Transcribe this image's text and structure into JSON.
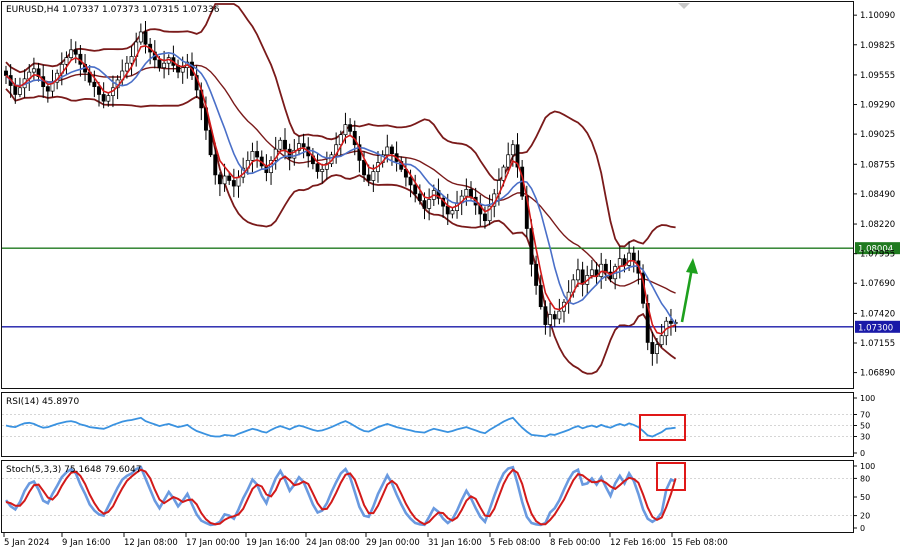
{
  "chart_data": {
    "type": "candlestick",
    "symbol_info": "EURUSD,H4  1.07337 1.07373 1.07315 1.07336",
    "price_axis": {
      "range": [
        1.0677,
        1.1019
      ],
      "ticks": [
        "1.10090",
        "1.09825",
        "1.09555",
        "1.09290",
        "1.09025",
        "1.08755",
        "1.08490",
        "1.08220",
        "1.07955",
        "1.07690",
        "1.07420",
        "1.07155",
        "1.06890"
      ],
      "tick_values": [
        1.1009,
        1.09825,
        1.09555,
        1.0929,
        1.09025,
        1.08755,
        1.0849,
        1.0822,
        1.07955,
        1.0769,
        1.0742,
        1.07155,
        1.0689
      ]
    },
    "x_axis_labels": [
      "5 Jan 2024",
      "9 Jan 16:00",
      "12 Jan 08:00",
      "17 Jan 00:00",
      "19 Jan 16:00",
      "24 Jan 08:00",
      "29 Jan 00:00",
      "31 Jan 16:00",
      "5 Feb 08:00",
      "8 Feb 00:00",
      "12 Feb 16:00",
      "15 Feb 08:00"
    ],
    "horizontal_lines": [
      {
        "label": "1.08004",
        "value": 1.08004,
        "color": "#1f7a1f"
      },
      {
        "label": "1.07300",
        "value": 1.073,
        "color": "#1a1aa8"
      }
    ],
    "closes": [
      1.0955,
      1.0946,
      1.0938,
      1.0944,
      1.0952,
      1.0958,
      1.0961,
      1.0954,
      1.0945,
      1.0941,
      1.0949,
      1.0957,
      1.0965,
      1.0971,
      1.0978,
      1.0974,
      1.0965,
      1.0958,
      1.0949,
      1.0945,
      1.0938,
      1.0932,
      1.0937,
      1.0944,
      1.0951,
      1.0959,
      1.0966,
      1.0972,
      1.0985,
      1.0994,
      1.0983,
      1.0976,
      1.0969,
      1.0962,
      1.0966,
      1.0971,
      1.0964,
      1.0958,
      1.0962,
      1.0967,
      1.0955,
      1.0942,
      1.0926,
      1.0906,
      1.0884,
      1.0866,
      1.0858,
      1.0865,
      1.0861,
      1.0856,
      1.0864,
      1.0872,
      1.0879,
      1.0887,
      1.0882,
      1.0874,
      1.0868,
      1.0879,
      1.0889,
      1.0897,
      1.0889,
      1.0881,
      1.0888,
      1.0894,
      1.0891,
      1.0883,
      1.0876,
      1.0869,
      1.0871,
      1.0876,
      1.0884,
      1.0893,
      1.0902,
      1.0911,
      1.0905,
      1.0893,
      1.0879,
      1.0866,
      1.0861,
      1.0869,
      1.0877,
      1.0884,
      1.0891,
      1.0885,
      1.0878,
      1.0871,
      1.0864,
      1.0857,
      1.0849,
      1.0843,
      1.0836,
      1.0844,
      1.0852,
      1.0845,
      1.0838,
      1.0831,
      1.0834,
      1.0841,
      1.0847,
      1.0853,
      1.0846,
      1.0839,
      1.0831,
      1.0825,
      1.0838,
      1.0849,
      1.0861,
      1.0873,
      1.0884,
      1.0893,
      1.0873,
      1.0847,
      1.0818,
      1.0786,
      1.0767,
      1.0748,
      1.0732,
      1.0741,
      1.0737,
      1.0744,
      1.0752,
      1.0761,
      1.0772,
      1.0781,
      1.0768,
      1.0776,
      1.0781,
      1.0775,
      1.0786,
      1.0779,
      1.0773,
      1.0784,
      1.0791,
      1.0785,
      1.0796,
      1.0789,
      1.0778,
      1.0751,
      1.0716,
      1.0706,
      1.0714,
      1.0722,
      1.0735,
      1.0733,
      1.0734
    ],
    "rsi": {
      "label": "RSI(14) 45.8970",
      "range": [
        0,
        100
      ],
      "ticks": [
        100,
        70,
        50,
        30,
        0
      ],
      "values": [
        50,
        48,
        47,
        51,
        54,
        55,
        53,
        49,
        46,
        47,
        50,
        53,
        55,
        57,
        58,
        56,
        52,
        50,
        47,
        46,
        45,
        44,
        47,
        51,
        54,
        57,
        59,
        60,
        62,
        64,
        58,
        55,
        52,
        49,
        51,
        53,
        50,
        47,
        49,
        51,
        45,
        40,
        37,
        34,
        31,
        30,
        30,
        33,
        32,
        31,
        35,
        38,
        41,
        44,
        42,
        39,
        37,
        42,
        46,
        49,
        46,
        43,
        47,
        50,
        48,
        45,
        42,
        40,
        41,
        44,
        47,
        51,
        55,
        58,
        54,
        49,
        44,
        40,
        39,
        43,
        47,
        50,
        53,
        50,
        47,
        45,
        43,
        41,
        39,
        38,
        37,
        41,
        44,
        42,
        40,
        38,
        40,
        43,
        45,
        47,
        44,
        41,
        38,
        36,
        42,
        47,
        52,
        57,
        61,
        64,
        55,
        46,
        39,
        33,
        32,
        31,
        30,
        34,
        33,
        36,
        39,
        42,
        46,
        49,
        45,
        48,
        50,
        47,
        51,
        48,
        46,
        50,
        53,
        50,
        54,
        51,
        47,
        40,
        32,
        30,
        34,
        38,
        44,
        45,
        46
      ]
    },
    "stoch": {
      "label": "Stoch(5,3,3) 75.1648 79.6047",
      "range": [
        0,
        100
      ],
      "ticks": [
        100,
        80,
        50,
        20,
        0
      ],
      "main": [
        45,
        35,
        30,
        42,
        60,
        72,
        75,
        62,
        44,
        40,
        55,
        68,
        82,
        90,
        95,
        88,
        70,
        55,
        38,
        28,
        22,
        20,
        35,
        50,
        65,
        78,
        84,
        88,
        95,
        98,
        80,
        62,
        44,
        32,
        45,
        58,
        48,
        35,
        44,
        55,
        38,
        22,
        12,
        8,
        5,
        6,
        10,
        22,
        20,
        15,
        30,
        48,
        62,
        78,
        70,
        52,
        40,
        62,
        80,
        92,
        78,
        60,
        70,
        82,
        74,
        56,
        38,
        25,
        28,
        40,
        58,
        74,
        88,
        95,
        82,
        58,
        34,
        20,
        18,
        35,
        55,
        70,
        85,
        72,
        54,
        38,
        24,
        15,
        8,
        6,
        5,
        18,
        32,
        26,
        15,
        8,
        14,
        28,
        45,
        60,
        48,
        32,
        18,
        10,
        30,
        52,
        72,
        88,
        96,
        98,
        72,
        42,
        18,
        8,
        6,
        5,
        8,
        25,
        32,
        45,
        62,
        78,
        90,
        94,
        70,
        72,
        80,
        70,
        82,
        66,
        52,
        72,
        84,
        72,
        88,
        76,
        55,
        30,
        15,
        10,
        15,
        25,
        62,
        78,
        75
      ],
      "signal": [
        42,
        40,
        36,
        36,
        44,
        58,
        69,
        70,
        60,
        49,
        46,
        54,
        68,
        80,
        89,
        91,
        84,
        71,
        54,
        40,
        29,
        23,
        26,
        35,
        50,
        64,
        76,
        83,
        89,
        94,
        91,
        80,
        62,
        46,
        40,
        45,
        50,
        47,
        42,
        45,
        46,
        38,
        24,
        14,
        8,
        6,
        7,
        13,
        17,
        19,
        22,
        31,
        47,
        63,
        70,
        67,
        54,
        51,
        61,
        78,
        83,
        77,
        69,
        71,
        75,
        71,
        56,
        40,
        30,
        31,
        42,
        57,
        73,
        86,
        88,
        78,
        58,
        37,
        24,
        24,
        36,
        53,
        70,
        76,
        70,
        55,
        39,
        26,
        16,
        10,
        6,
        10,
        18,
        25,
        24,
        16,
        12,
        17,
        29,
        44,
        51,
        47,
        33,
        20,
        19,
        31,
        51,
        71,
        85,
        94,
        89,
        71,
        44,
        23,
        11,
        6,
        6,
        13,
        22,
        34,
        46,
        62,
        77,
        87,
        85,
        79,
        74,
        74,
        77,
        73,
        67,
        63,
        69,
        76,
        81,
        79,
        73,
        54,
        33,
        18,
        13,
        17,
        34,
        55,
        80
      ]
    },
    "annotations": [
      {
        "type": "arrow",
        "color": "#1ea01e"
      },
      {
        "type": "box",
        "color": "#e01818"
      },
      {
        "type": "box",
        "color": "#e01818"
      }
    ],
    "colors": {
      "bull_body": "#ffffff",
      "bear_body": "#000000",
      "wick": "#000000",
      "bollinger": "#7a1a1a",
      "ma_fast": "#d21a1a",
      "ma_slow": "#4a6fc8",
      "rsi_line": "#3a92e0",
      "stoch_main": "#6a9ae0",
      "stoch_signal": "#d21a1a"
    }
  }
}
